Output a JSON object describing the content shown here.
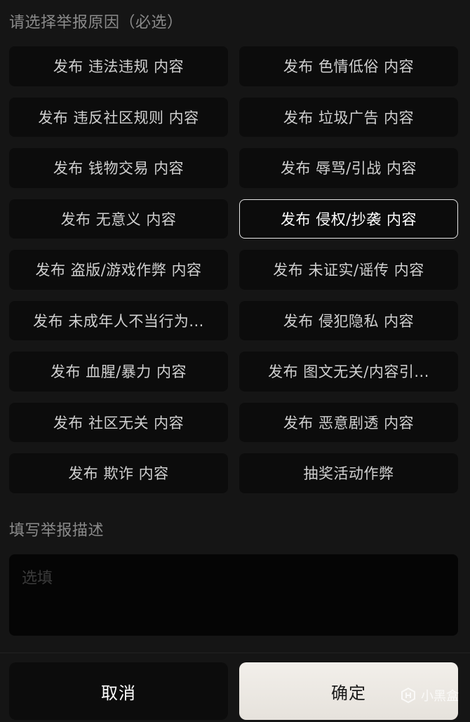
{
  "reason_section": {
    "title": "请选择举报原因（必选）",
    "reasons": [
      {
        "label": "发布 违法违规 内容",
        "selected": false
      },
      {
        "label": "发布 色情低俗 内容",
        "selected": false
      },
      {
        "label": "发布 违反社区规则 内容",
        "selected": false
      },
      {
        "label": "发布 垃圾广告 内容",
        "selected": false
      },
      {
        "label": "发布 钱物交易 内容",
        "selected": false
      },
      {
        "label": "发布 辱骂/引战 内容",
        "selected": false
      },
      {
        "label": "发布 无意义 内容",
        "selected": false
      },
      {
        "label": "发布 侵权/抄袭 内容",
        "selected": true
      },
      {
        "label": "发布 盗版/游戏作弊 内容",
        "selected": false
      },
      {
        "label": "发布 未证实/谣传 内容",
        "selected": false
      },
      {
        "label": "发布 未成年人不当行为...",
        "selected": false
      },
      {
        "label": "发布 侵犯隐私 内容",
        "selected": false
      },
      {
        "label": "发布 血腥/暴力 内容",
        "selected": false
      },
      {
        "label": "发布 图文无关/内容引...",
        "selected": false
      },
      {
        "label": "发布 社区无关 内容",
        "selected": false
      },
      {
        "label": "发布 恶意剧透 内容",
        "selected": false
      },
      {
        "label": "发布 欺诈 内容",
        "selected": false
      },
      {
        "label": "抽奖活动作弊",
        "selected": false
      }
    ]
  },
  "description_section": {
    "title": "填写举报描述",
    "value": "",
    "placeholder": "选填"
  },
  "actions": {
    "cancel_label": "取消",
    "confirm_label": "确定"
  },
  "watermark": {
    "text": "小黑盒",
    "icon": "heybox-logo-icon"
  },
  "colors": {
    "background": "#151515",
    "button_bg": "#0c0c0c",
    "selected_border": "#e6e6e6",
    "confirm_bg": "#ece8e2"
  }
}
